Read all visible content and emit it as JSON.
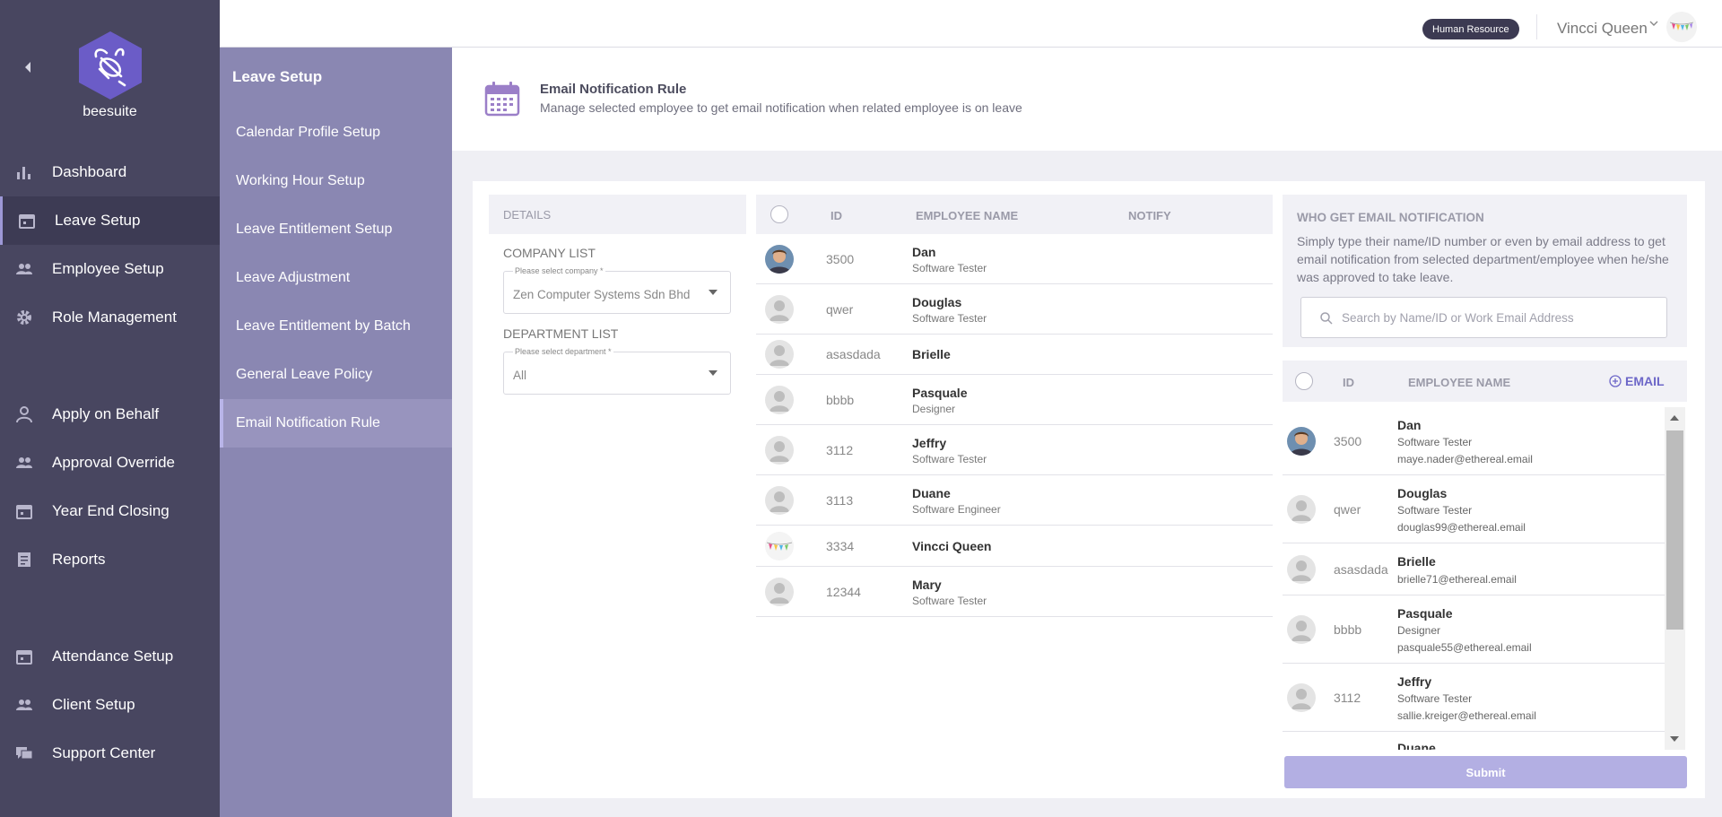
{
  "app": {
    "name": "beesuite"
  },
  "topbar": {
    "role_badge": "Human Resource",
    "user_name": "Vincci Queen"
  },
  "sidebar": {
    "items": [
      {
        "label": "Dashboard",
        "icon": "bar-chart-icon"
      },
      {
        "label": "Leave Setup",
        "icon": "calendar-icon",
        "active": true
      },
      {
        "label": "Employee Setup",
        "icon": "people-icon"
      },
      {
        "label": "Role Management",
        "icon": "gear-icon"
      },
      {
        "label": "Apply on Behalf",
        "icon": "person-icon"
      },
      {
        "label": "Approval Override",
        "icon": "people-icon"
      },
      {
        "label": "Year End Closing",
        "icon": "calendar-icon"
      },
      {
        "label": "Reports",
        "icon": "report-icon"
      },
      {
        "label": "Attendance Setup",
        "icon": "calendar-icon"
      },
      {
        "label": "Client Setup",
        "icon": "people-icon"
      },
      {
        "label": "Support Center",
        "icon": "chat-icon"
      }
    ]
  },
  "subnav": {
    "title": "Leave Setup",
    "items": [
      {
        "label": "Calendar Profile Setup"
      },
      {
        "label": "Working Hour Setup"
      },
      {
        "label": "Leave Entitlement Setup"
      },
      {
        "label": "Leave Adjustment"
      },
      {
        "label": "Leave Entitlement by Batch"
      },
      {
        "label": "General Leave Policy"
      },
      {
        "label": "Email Notification Rule",
        "active": true
      }
    ]
  },
  "header": {
    "title": "Email Notification Rule",
    "subtitle": "Manage selected employee to get email notification when related employee is on leave"
  },
  "details": {
    "heading": "DETAILS",
    "company_label": "COMPANY LIST",
    "company_float": "Please select company *",
    "company_value": "Zen Computer Systems Sdn Bhd",
    "department_label": "DEPARTMENT LIST",
    "department_float": "Please select department *",
    "department_value": "All"
  },
  "employees": {
    "columns": {
      "id": "ID",
      "name": "EMPLOYEE NAME",
      "notify": "NOTIFY"
    },
    "rows": [
      {
        "id": "3500",
        "name": "Dan",
        "role": "Software Tester",
        "avatar": "photo"
      },
      {
        "id": "qwer",
        "name": "Douglas",
        "role": "Software Tester",
        "avatar": "default"
      },
      {
        "id": "asasdada",
        "name": "Brielle",
        "role": "",
        "avatar": "default"
      },
      {
        "id": "bbbb",
        "name": "Pasquale",
        "role": "Designer",
        "avatar": "default"
      },
      {
        "id": "3112",
        "name": "Jeffry",
        "role": "Software Tester",
        "avatar": "default"
      },
      {
        "id": "3113",
        "name": "Duane",
        "role": "Software Engineer",
        "avatar": "default"
      },
      {
        "id": "3334",
        "name": "Vincci Queen",
        "role": "",
        "avatar": "bunting"
      },
      {
        "id": "12344",
        "name": "Mary",
        "role": "Software Tester",
        "avatar": "default"
      }
    ]
  },
  "who": {
    "title": "WHO GET EMAIL NOTIFICATION",
    "description": "Simply type their name/ID number or even by email address to get email notification from selected department/employee when he/she was approved to take leave.",
    "search_placeholder": "Search by Name/ID or Work Email Address"
  },
  "notify_list": {
    "columns": {
      "id": "ID",
      "name": "EMPLOYEE NAME",
      "email_button": "EMAIL"
    },
    "rows": [
      {
        "id": "3500",
        "name": "Dan",
        "role": "Software Tester",
        "email": "maye.nader@ethereal.email",
        "avatar": "photo"
      },
      {
        "id": "qwer",
        "name": "Douglas",
        "role": "Software Tester",
        "email": "douglas99@ethereal.email",
        "avatar": "default"
      },
      {
        "id": "asasdada",
        "name": "Brielle",
        "role": "",
        "email": "brielle71@ethereal.email",
        "avatar": "default"
      },
      {
        "id": "bbbb",
        "name": "Pasquale",
        "role": "Designer",
        "email": "pasquale55@ethereal.email",
        "avatar": "default"
      },
      {
        "id": "3112",
        "name": "Jeffry",
        "role": "Software Tester",
        "email": "sallie.kreiger@ethereal.email",
        "avatar": "default"
      },
      {
        "id": "",
        "name": "Duane",
        "role": "",
        "email": "",
        "avatar": "default"
      }
    ]
  },
  "actions": {
    "submit": "Submit"
  },
  "colors": {
    "sidebar": "#484660",
    "subnav": "#8a87b2",
    "accent": "#6d67c8",
    "submit": "#b3afe3",
    "badge": "#3c3a52"
  }
}
